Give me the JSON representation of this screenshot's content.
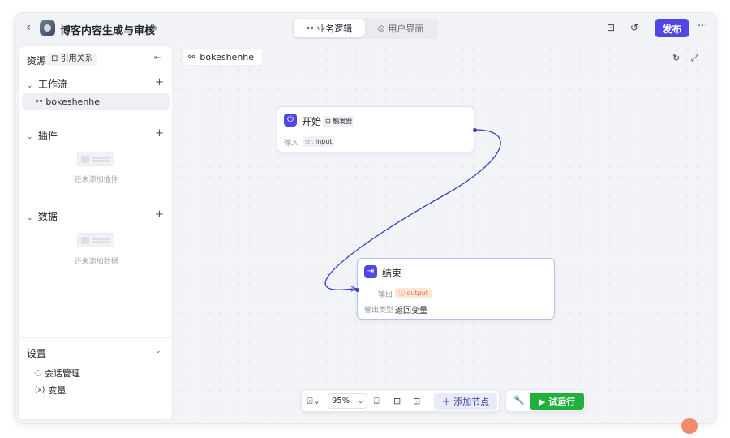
{
  "header": {
    "title": "博客内容生成与审核",
    "tabs": [
      {
        "label": "业务逻辑",
        "active": true
      },
      {
        "label": "用户界面",
        "active": false
      }
    ],
    "publish_label": "发布"
  },
  "sidebar": {
    "resources_label": "资源",
    "ref_chip": "引用关系",
    "workflow": {
      "title": "工作流",
      "items": [
        "bokeshenhe"
      ]
    },
    "plugins": {
      "title": "插件",
      "empty_text": "还未添加插件"
    },
    "data": {
      "title": "数据",
      "empty_text": "还未添加数据"
    },
    "settings": {
      "title": "设置",
      "items": [
        "会话管理",
        "变量"
      ]
    }
  },
  "canvas": {
    "tab_label": "bokeshenhe",
    "start_node": {
      "title": "开始",
      "badge": "触发器",
      "input_label": "输入",
      "input_type": "str.",
      "input_name": "input"
    },
    "end_node": {
      "title": "结束",
      "output_label": "输出",
      "output_name": "output",
      "output_type_label": "输出类型",
      "output_type_value": "返回变量"
    },
    "toolbar": {
      "zoom": "95%",
      "add_node_label": "添加节点",
      "run_label": "试运行"
    }
  },
  "colors": {
    "accent": "#5147e5",
    "run": "#1fb13c",
    "edge": "#3a3fc4"
  }
}
